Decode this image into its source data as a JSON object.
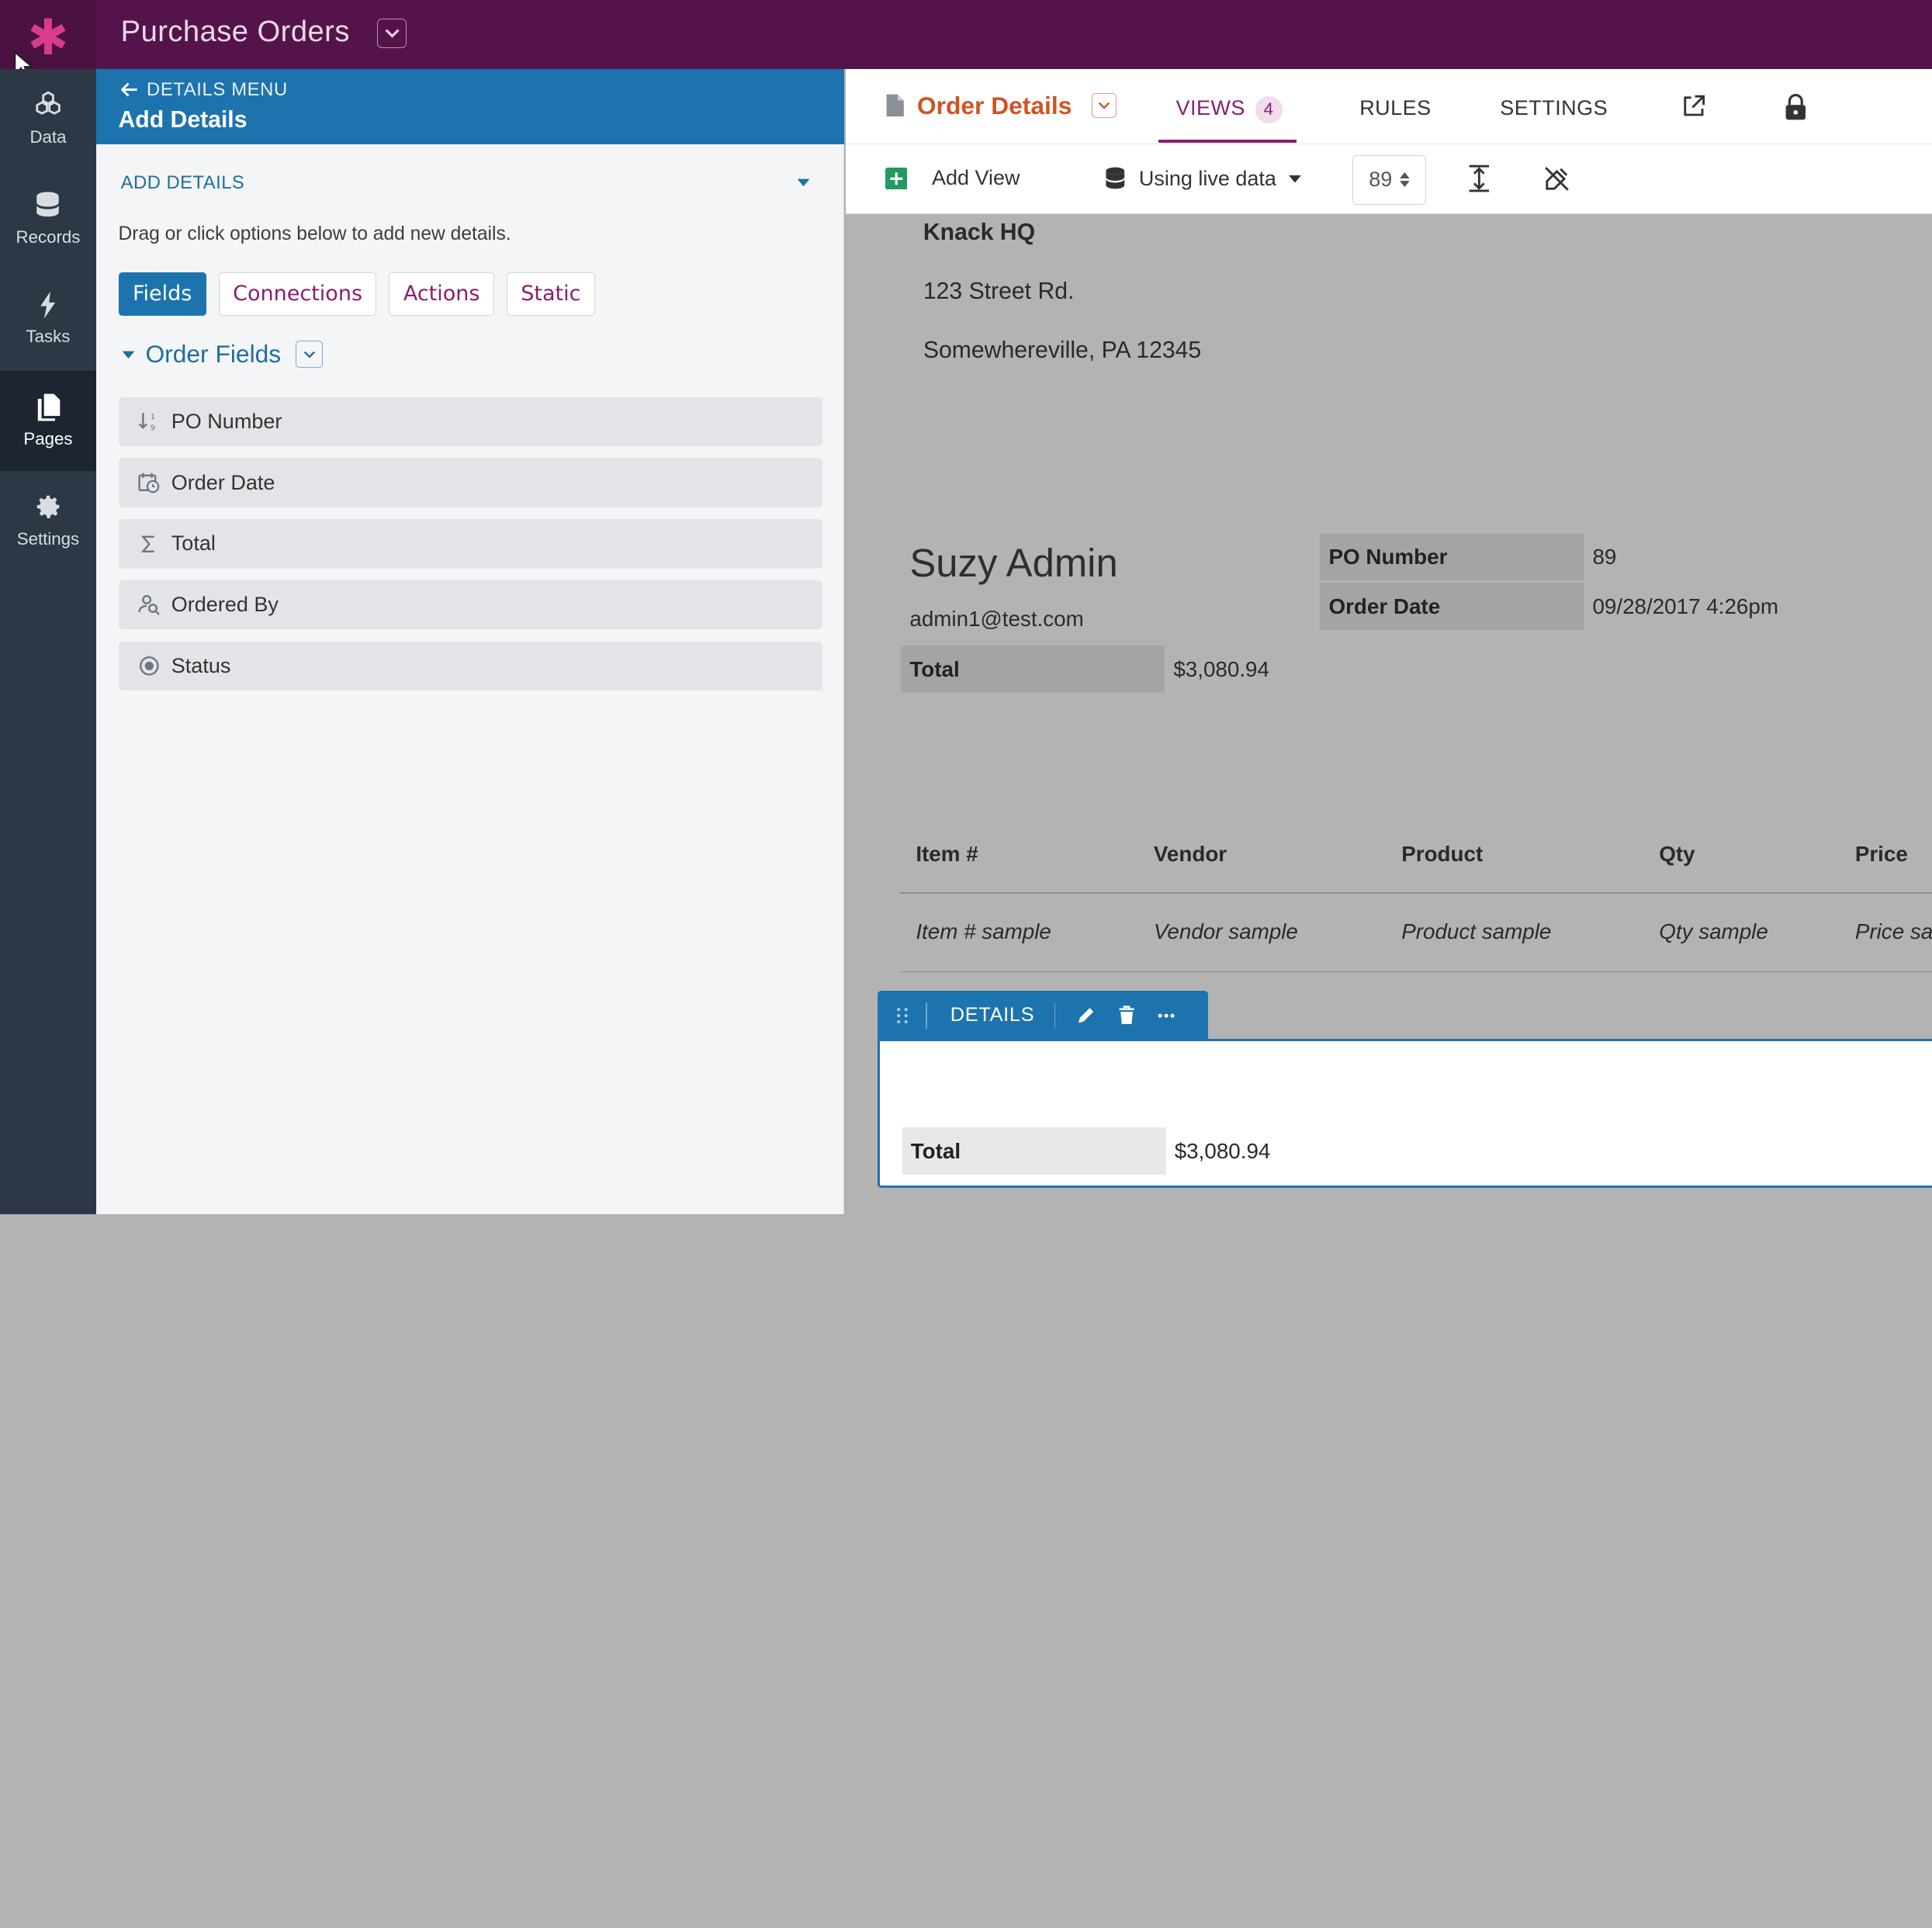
{
  "app": {
    "title": "Purchase Orders"
  },
  "nav": {
    "items": [
      {
        "label": "Data",
        "icon": "data-icon"
      },
      {
        "label": "Records",
        "icon": "records-icon"
      },
      {
        "label": "Tasks",
        "icon": "tasks-icon"
      },
      {
        "label": "Pages",
        "icon": "pages-icon",
        "active": true
      },
      {
        "label": "Settings",
        "icon": "settings-icon"
      }
    ]
  },
  "panel": {
    "back_label": "DETAILS MENU",
    "title": "Add Details",
    "section_label": "ADD DETAILS",
    "hint": "Drag or click options below to add new details.",
    "tabs": [
      "Fields",
      "Connections",
      "Actions",
      "Static"
    ],
    "active_tab": "Fields",
    "group_title": "Order Fields",
    "fields": [
      {
        "label": "PO Number",
        "icon": "auto-increment-icon"
      },
      {
        "label": "Order Date",
        "icon": "date-time-icon"
      },
      {
        "label": "Total",
        "icon": "sum-icon"
      },
      {
        "label": "Ordered By",
        "icon": "user-search-icon"
      },
      {
        "label": "Status",
        "icon": "radio-icon"
      }
    ]
  },
  "toolbar": {
    "view_name": "Order Details",
    "tabs": {
      "views": "VIEWS",
      "views_count": "4",
      "rules": "RULES",
      "settings": "SETTINGS"
    },
    "add_view": "Add View",
    "live_data": "Using live data",
    "record_id": "89"
  },
  "canvas": {
    "company": "Knack HQ",
    "address1": "123 Street Rd.",
    "address2": "Somewhereville, PA 12345",
    "user_name": "Suzy Admin",
    "user_email": "admin1@test.com",
    "details": [
      {
        "key": "PO Number",
        "value": "89"
      },
      {
        "key": "Order Date",
        "value": "09/28/2017 4:26pm"
      }
    ],
    "total_label": "Total",
    "total_value": "$3,080.94",
    "table": {
      "headers": [
        "Item #",
        "Vendor",
        "Product",
        "Qty",
        "Price"
      ],
      "row": [
        "Item # sample",
        "Vendor sample",
        "Product sample",
        "Qty sample",
        "Price sa"
      ]
    },
    "details_bar_label": "DETAILS",
    "bottom_total_label": "Total",
    "bottom_total_value": "$3,080.94"
  }
}
